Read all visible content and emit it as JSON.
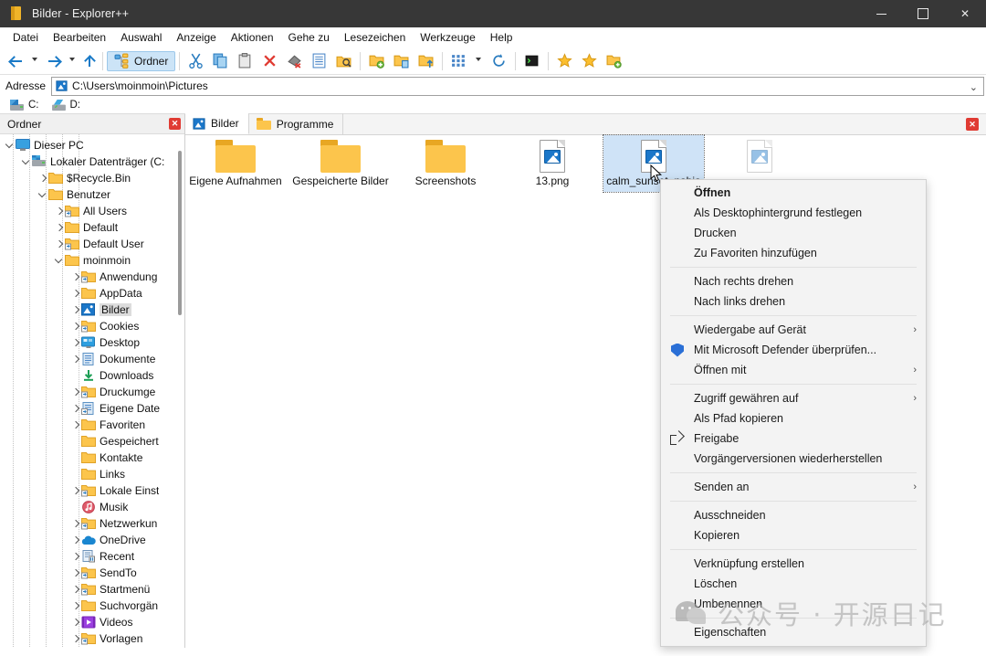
{
  "window": {
    "title": "Bilder - Explorer++",
    "app_icon": "folder-icon",
    "minimize_label": "",
    "maximize_label": "",
    "close_label": "✕"
  },
  "menubar": {
    "items": [
      {
        "label": "Datei"
      },
      {
        "label": "Bearbeiten"
      },
      {
        "label": "Auswahl"
      },
      {
        "label": "Anzeige"
      },
      {
        "label": "Aktionen"
      },
      {
        "label": "Gehe zu"
      },
      {
        "label": "Lesezeichen"
      },
      {
        "label": "Werkzeuge"
      },
      {
        "label": "Help"
      }
    ]
  },
  "toolbar": {
    "folders_label": "Ordner",
    "buttons": [
      {
        "name": "back",
        "icon": "arrow-left-icon"
      },
      {
        "name": "back-dropdown",
        "icon": "caret-down-icon"
      },
      {
        "name": "forward",
        "icon": "arrow-right-icon"
      },
      {
        "name": "forward-dropdown",
        "icon": "caret-down-icon"
      },
      {
        "name": "up",
        "icon": "arrow-up-icon"
      },
      {
        "name": "folders-pane",
        "icon": "tree-icon"
      },
      {
        "name": "cut",
        "icon": "scissors-icon"
      },
      {
        "name": "copy",
        "icon": "copy-icon"
      },
      {
        "name": "paste",
        "icon": "clipboard-icon"
      },
      {
        "name": "delete",
        "icon": "red-x-icon"
      },
      {
        "name": "delete-permanently",
        "icon": "eraser-x-icon"
      },
      {
        "name": "properties",
        "icon": "properties-icon"
      },
      {
        "name": "search",
        "icon": "folder-search-icon"
      },
      {
        "name": "new-folder",
        "icon": "folder-new-icon"
      },
      {
        "name": "copy-to-folder",
        "icon": "folder-copy-icon"
      },
      {
        "name": "move-to-folder",
        "icon": "folder-move-icon"
      },
      {
        "name": "views",
        "icon": "grid-icon"
      },
      {
        "name": "views-dropdown",
        "icon": "caret-down-icon"
      },
      {
        "name": "refresh",
        "icon": "refresh-icon"
      },
      {
        "name": "terminal",
        "icon": "terminal-icon"
      },
      {
        "name": "bookmark-add",
        "icon": "star-outline-icon"
      },
      {
        "name": "bookmarks",
        "icon": "star-icon"
      },
      {
        "name": "new-tab",
        "icon": "tab-new-icon"
      }
    ]
  },
  "address": {
    "label": "Adresse",
    "icon": "pictures-folder-icon",
    "value": "C:\\Users\\moinmoin\\Pictures",
    "dropdown_icon": "chevron-down-icon"
  },
  "drives": {
    "items": [
      {
        "label": "C:",
        "icon": "hard-drive-icon"
      },
      {
        "label": "D:",
        "icon": "optical-drive-icon"
      }
    ]
  },
  "sidebar": {
    "header_title": "Ordner",
    "close_label": "✕",
    "tree": [
      {
        "label": "Dieser PC",
        "depth": 0,
        "icon": "this-pc-icon",
        "chevron": "open",
        "selected": false
      },
      {
        "label": "Lokaler Datenträger (C:",
        "depth": 1,
        "icon": "hard-drive-icon",
        "chevron": "open",
        "selected": false
      },
      {
        "label": "$Recycle.Bin",
        "depth": 2,
        "icon": "folder-icon",
        "chevron": "closed",
        "selected": false
      },
      {
        "label": "Benutzer",
        "depth": 2,
        "icon": "folder-icon",
        "chevron": "open",
        "selected": false
      },
      {
        "label": "All Users",
        "depth": 3,
        "icon": "folder-shortcut-icon",
        "chevron": "closed",
        "selected": false
      },
      {
        "label": "Default",
        "depth": 3,
        "icon": "folder-icon",
        "chevron": "closed",
        "selected": false
      },
      {
        "label": "Default User",
        "depth": 3,
        "icon": "folder-shortcut-icon",
        "chevron": "closed",
        "selected": false
      },
      {
        "label": "moinmoin",
        "depth": 3,
        "icon": "folder-icon",
        "chevron": "open",
        "selected": false
      },
      {
        "label": "Anwendung",
        "depth": 4,
        "icon": "folder-shortcut-icon",
        "chevron": "closed",
        "selected": false
      },
      {
        "label": "AppData",
        "depth": 4,
        "icon": "folder-icon",
        "chevron": "closed",
        "selected": false
      },
      {
        "label": "Bilder",
        "depth": 4,
        "icon": "pictures-folder-icon",
        "chevron": "closed",
        "selected": true
      },
      {
        "label": "Cookies",
        "depth": 4,
        "icon": "folder-shortcut-icon",
        "chevron": "closed",
        "selected": false
      },
      {
        "label": "Desktop",
        "depth": 4,
        "icon": "desktop-folder-icon",
        "chevron": "closed",
        "selected": false
      },
      {
        "label": "Dokumente",
        "depth": 4,
        "icon": "documents-folder-icon",
        "chevron": "closed",
        "selected": false
      },
      {
        "label": "Downloads",
        "depth": 4,
        "icon": "downloads-icon",
        "chevron": "none",
        "selected": false
      },
      {
        "label": "Druckumge",
        "depth": 4,
        "icon": "folder-shortcut-icon",
        "chevron": "closed",
        "selected": false
      },
      {
        "label": "Eigene Date",
        "depth": 4,
        "icon": "documents-shortcut-icon",
        "chevron": "closed",
        "selected": false
      },
      {
        "label": "Favoriten",
        "depth": 4,
        "icon": "folder-icon",
        "chevron": "closed",
        "selected": false
      },
      {
        "label": "Gespeichert",
        "depth": 4,
        "icon": "folder-icon",
        "chevron": "none",
        "selected": false
      },
      {
        "label": "Kontakte",
        "depth": 4,
        "icon": "folder-icon",
        "chevron": "none",
        "selected": false
      },
      {
        "label": "Links",
        "depth": 4,
        "icon": "folder-icon",
        "chevron": "none",
        "selected": false
      },
      {
        "label": "Lokale Einst",
        "depth": 4,
        "icon": "folder-shortcut-icon",
        "chevron": "closed",
        "selected": false
      },
      {
        "label": "Musik",
        "depth": 4,
        "icon": "music-folder-icon",
        "chevron": "none",
        "selected": false
      },
      {
        "label": "Netzwerkun",
        "depth": 4,
        "icon": "folder-shortcut-icon",
        "chevron": "closed",
        "selected": false
      },
      {
        "label": "OneDrive",
        "depth": 4,
        "icon": "onedrive-icon",
        "chevron": "closed",
        "selected": false
      },
      {
        "label": "Recent",
        "depth": 4,
        "icon": "recent-icon",
        "chevron": "closed",
        "selected": false
      },
      {
        "label": "SendTo",
        "depth": 4,
        "icon": "folder-shortcut-icon",
        "chevron": "closed",
        "selected": false
      },
      {
        "label": "Startmenü",
        "depth": 4,
        "icon": "folder-shortcut-icon",
        "chevron": "closed",
        "selected": false
      },
      {
        "label": "Suchvorgän",
        "depth": 4,
        "icon": "folder-icon",
        "chevron": "closed",
        "selected": false
      },
      {
        "label": "Videos",
        "depth": 4,
        "icon": "videos-folder-icon",
        "chevron": "closed",
        "selected": false
      },
      {
        "label": "Vorlagen",
        "depth": 4,
        "icon": "folder-shortcut-icon",
        "chevron": "closed",
        "selected": false
      }
    ]
  },
  "tabs": {
    "items": [
      {
        "label": "Bilder",
        "icon": "pictures-folder-icon",
        "active": true
      },
      {
        "label": "Programme",
        "icon": "folder-icon",
        "active": false
      }
    ],
    "close_label": "✕"
  },
  "files": [
    {
      "name": "Eigene Aufnahmen",
      "type": "folder",
      "selected": false,
      "ghost": false
    },
    {
      "name": "Gespeicherte Bilder",
      "type": "folder",
      "selected": false,
      "ghost": false
    },
    {
      "name": "Screenshots",
      "type": "folder",
      "selected": false,
      "ghost": false
    },
    {
      "name": "13.png",
      "type": "image",
      "selected": false,
      "ghost": false
    },
    {
      "name": "calm_sunset_nabia",
      "type": "image",
      "selected": true,
      "ghost": false
    },
    {
      "name": "",
      "type": "image",
      "selected": false,
      "ghost": true
    }
  ],
  "context_menu": {
    "items": [
      {
        "label": "Öffnen",
        "bold": true,
        "icon": "",
        "submenu": false,
        "type": "item"
      },
      {
        "label": "Als Desktophintergrund festlegen",
        "bold": false,
        "icon": "",
        "submenu": false,
        "type": "item"
      },
      {
        "label": "Drucken",
        "bold": false,
        "icon": "",
        "submenu": false,
        "type": "item"
      },
      {
        "label": "Zu Favoriten hinzufügen",
        "bold": false,
        "icon": "",
        "submenu": false,
        "type": "item"
      },
      {
        "type": "separator"
      },
      {
        "label": "Nach rechts drehen",
        "bold": false,
        "icon": "",
        "submenu": false,
        "type": "item"
      },
      {
        "label": "Nach links drehen",
        "bold": false,
        "icon": "",
        "submenu": false,
        "type": "item"
      },
      {
        "type": "separator"
      },
      {
        "label": "Wiedergabe auf Gerät",
        "bold": false,
        "icon": "",
        "submenu": true,
        "type": "item"
      },
      {
        "label": "Mit Microsoft Defender überprüfen...",
        "bold": false,
        "icon": "shield-icon",
        "submenu": false,
        "type": "item"
      },
      {
        "label": "Öffnen mit",
        "bold": false,
        "icon": "",
        "submenu": true,
        "type": "item"
      },
      {
        "type": "separator"
      },
      {
        "label": "Zugriff gewähren auf",
        "bold": false,
        "icon": "",
        "submenu": true,
        "type": "item"
      },
      {
        "label": "Als Pfad kopieren",
        "bold": false,
        "icon": "",
        "submenu": false,
        "type": "item"
      },
      {
        "label": "Freigabe",
        "bold": false,
        "icon": "share-icon",
        "submenu": false,
        "type": "item"
      },
      {
        "label": "Vorgängerversionen wiederherstellen",
        "bold": false,
        "icon": "",
        "submenu": false,
        "type": "item"
      },
      {
        "type": "separator"
      },
      {
        "label": "Senden an",
        "bold": false,
        "icon": "",
        "submenu": true,
        "type": "item"
      },
      {
        "type": "separator"
      },
      {
        "label": "Ausschneiden",
        "bold": false,
        "icon": "",
        "submenu": false,
        "type": "item"
      },
      {
        "label": "Kopieren",
        "bold": false,
        "icon": "",
        "submenu": false,
        "type": "item"
      },
      {
        "type": "separator"
      },
      {
        "label": "Verknüpfung erstellen",
        "bold": false,
        "icon": "",
        "submenu": false,
        "type": "item"
      },
      {
        "label": "Löschen",
        "bold": false,
        "icon": "",
        "submenu": false,
        "type": "item"
      },
      {
        "label": "Umbenennen",
        "bold": false,
        "icon": "",
        "submenu": false,
        "type": "item"
      },
      {
        "type": "separator"
      },
      {
        "label": "Eigenschaften",
        "bold": false,
        "icon": "",
        "submenu": false,
        "type": "item"
      }
    ],
    "submenu_glyph": "›"
  },
  "watermark": {
    "text": "公众号 · 开源日记"
  },
  "colors": {
    "titlebar_bg": "#373737",
    "accent_blue": "#1a7ac7",
    "selection_blue": "#cfe3f7",
    "menu_bg": "#f3f3f3",
    "folder_yellow": "#fcc54c",
    "close_red": "#e03b33"
  }
}
